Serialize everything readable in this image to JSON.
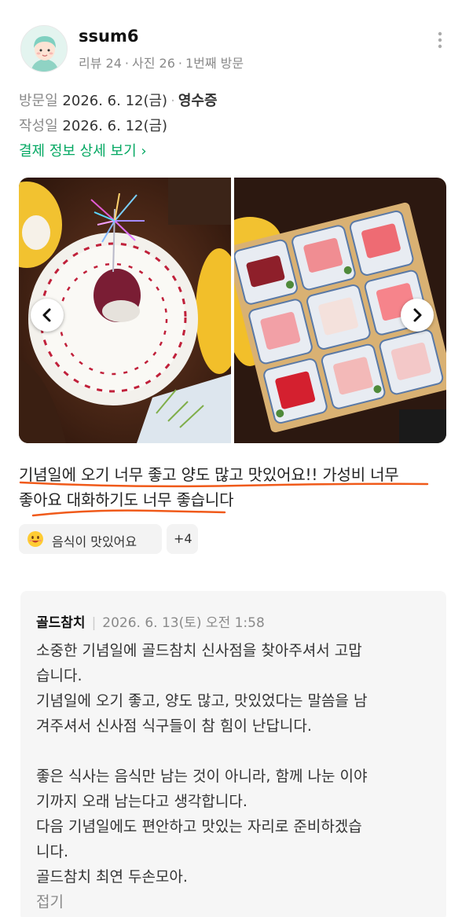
{
  "user": {
    "name": "ssum6",
    "reviews": "리뷰 24",
    "photos": "사진 26",
    "visits": "1번째 방문"
  },
  "visit": {
    "visit_label": "방문일",
    "visit_date": "2026. 6. 12(금)",
    "receipt": "영수증",
    "written_label": "작성일",
    "written_date": "2026. 6. 12(금)",
    "payment_link": "결제 정보 상세 보기 ›"
  },
  "review": {
    "line1": "기념일에 오기 너무 좋고 양도 많고 맛있어요!! 가성비 너무",
    "line2": "좋아요 대화하기도 너무 좋습니다",
    "underline_color": "#f05a1a"
  },
  "tags": [
    {
      "label": "음식이 맛있어요",
      "icon": "smiling-face-emoji"
    },
    {
      "label": "+4"
    }
  ],
  "reply": {
    "owner": "골드참치",
    "separator": "|",
    "datetime": "2026. 6. 13(토) 오전 1:58",
    "lines": [
      "소중한 기념일에 골드참치 신사점을 찾아주셔서 고맙",
      "습니다.",
      "기념일에 오기 좋고, 양도 많고, 맛있었다는 말씀을 남",
      "겨주셔서 신사점 식구들이 참 힘이 난답니다.",
      "",
      "좋은 식사는 음식만 남는 것이 아니라, 함께 나눈 이야",
      "기까지 오래 남는다고 생각합니다.",
      "다음 기념일에도 편안하고 맛있는 자리로 준비하겠습",
      "니다.",
      "골드참치 최연 두손모아."
    ],
    "fold": "접기"
  },
  "colors": {
    "accent_green": "#03a862",
    "meta_gray": "#8a8a8a",
    "reply_bg": "#f6f6f6"
  }
}
